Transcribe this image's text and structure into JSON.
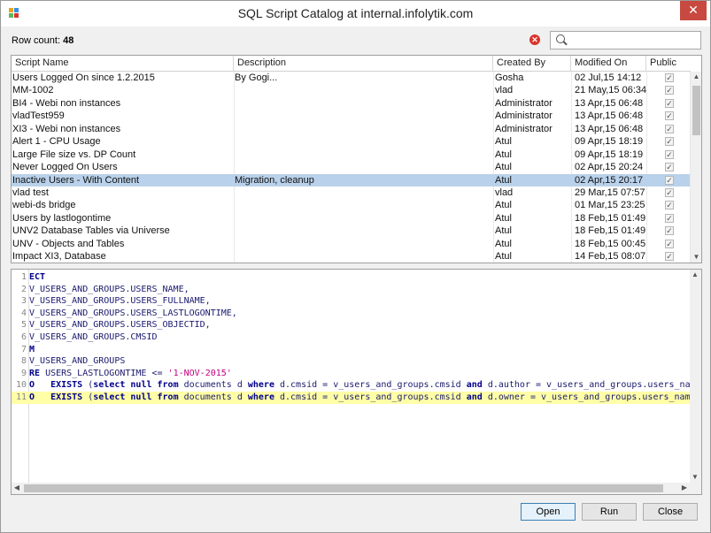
{
  "window": {
    "title": "SQL Script Catalog at internal.infolytik.com"
  },
  "toolbar": {
    "row_count_label": "Row count:",
    "row_count_value": "48",
    "search_value": ""
  },
  "grid": {
    "columns": [
      "Script Name",
      "Description",
      "Created By",
      "Modified On",
      "Public"
    ],
    "rows": [
      {
        "name": "Users Logged On since 1.2.2015",
        "desc": "By Gogi...",
        "by": "Gosha",
        "mod": "02 Jul,15 14:12",
        "public": true
      },
      {
        "name": "MM-1002",
        "desc": "",
        "by": "vlad",
        "mod": "21 May,15 06:34",
        "public": true
      },
      {
        "name": "BI4 - Webi non instances",
        "desc": "",
        "by": "Administrator",
        "mod": "13 Apr,15 06:48",
        "public": true
      },
      {
        "name": "vladTest959",
        "desc": "",
        "by": "Administrator",
        "mod": "13 Apr,15 06:48",
        "public": true
      },
      {
        "name": "XI3 - Webi non instances",
        "desc": "",
        "by": "Administrator",
        "mod": "13 Apr,15 06:48",
        "public": true
      },
      {
        "name": "Alert 1 - CPU Usage",
        "desc": "",
        "by": "Atul",
        "mod": "09 Apr,15 18:19",
        "public": true
      },
      {
        "name": "Large File size vs. DP Count",
        "desc": "",
        "by": "Atul",
        "mod": "09 Apr,15 18:19",
        "public": true
      },
      {
        "name": "Never Logged On Users",
        "desc": "",
        "by": "Atul",
        "mod": "02 Apr,15 20:24",
        "public": true
      },
      {
        "name": "Inactive Users - With Content",
        "desc": "Migration, cleanup",
        "by": "Atul",
        "mod": "02 Apr,15 20:17",
        "public": true,
        "selected": true
      },
      {
        "name": "vlad test",
        "desc": "",
        "by": "vlad",
        "mod": "29 Mar,15 07:57",
        "public": true
      },
      {
        "name": "webi-ds bridge",
        "desc": "",
        "by": "Atul",
        "mod": "01 Mar,15 23:25",
        "public": true
      },
      {
        "name": "Users by lastlogontime",
        "desc": "",
        "by": "Atul",
        "mod": "18 Feb,15 01:49",
        "public": true
      },
      {
        "name": "UNV2 Database Tables via Universe",
        "desc": "",
        "by": "Atul",
        "mod": "18 Feb,15 01:49",
        "public": true
      },
      {
        "name": "UNV - Objects and Tables",
        "desc": "",
        "by": "Atul",
        "mod": "18 Feb,15 00:45",
        "public": true
      },
      {
        "name": "Impact XI3, Database",
        "desc": "",
        "by": "Atul",
        "mod": "14 Feb,15 08:07",
        "public": true
      }
    ]
  },
  "editor": {
    "lines": [
      {
        "n": "1",
        "parts": [
          [
            "kw",
            "ECT"
          ]
        ]
      },
      {
        "n": "2",
        "parts": [
          [
            "txt",
            "V_USERS_AND_GROUPS.USERS_NAME,"
          ]
        ]
      },
      {
        "n": "3",
        "parts": [
          [
            "txt",
            "V_USERS_AND_GROUPS.USERS_FULLNAME,"
          ]
        ]
      },
      {
        "n": "4",
        "parts": [
          [
            "txt",
            "V_USERS_AND_GROUPS.USERS_LASTLOGONTIME,"
          ]
        ]
      },
      {
        "n": "5",
        "parts": [
          [
            "txt",
            "V_USERS_AND_GROUPS.USERS_OBJECTID,"
          ]
        ]
      },
      {
        "n": "6",
        "parts": [
          [
            "txt",
            "V_USERS_AND_GROUPS.CMSID"
          ]
        ]
      },
      {
        "n": "7",
        "parts": [
          [
            "kw",
            "M"
          ]
        ]
      },
      {
        "n": "8",
        "parts": [
          [
            "txt",
            "V_USERS_AND_GROUPS"
          ]
        ]
      },
      {
        "n": "9",
        "parts": [
          [
            "kw",
            "RE "
          ],
          [
            "txt",
            "USERS_LASTLOGONTIME <= "
          ],
          [
            "str",
            "'1-NOV-2015'"
          ]
        ]
      },
      {
        "n": "10",
        "parts": [
          [
            "kw",
            "O   EXISTS "
          ],
          [
            "txt",
            "("
          ],
          [
            "kw",
            "select null from "
          ],
          [
            "txt",
            "documents d "
          ],
          [
            "kw",
            "where "
          ],
          [
            "txt",
            "d.cmsid = v_users_and_groups.cmsid "
          ],
          [
            "kw",
            "and "
          ],
          [
            "txt",
            "d.author = v_users_and_groups.users_name"
          ]
        ]
      },
      {
        "n": "11",
        "parts": [
          [
            "kw",
            "O   EXISTS "
          ],
          [
            "txt",
            "("
          ],
          [
            "kw",
            "select null from "
          ],
          [
            "txt",
            "documents d "
          ],
          [
            "kw",
            "where "
          ],
          [
            "txt",
            "d.cmsid = v_users_and_groups.cmsid "
          ],
          [
            "kw",
            "and "
          ],
          [
            "txt",
            "d.owner = v_users_and_groups.users_name)"
          ]
        ],
        "highlight": true
      }
    ]
  },
  "buttons": {
    "open": "Open",
    "run": "Run",
    "close": "Close"
  }
}
